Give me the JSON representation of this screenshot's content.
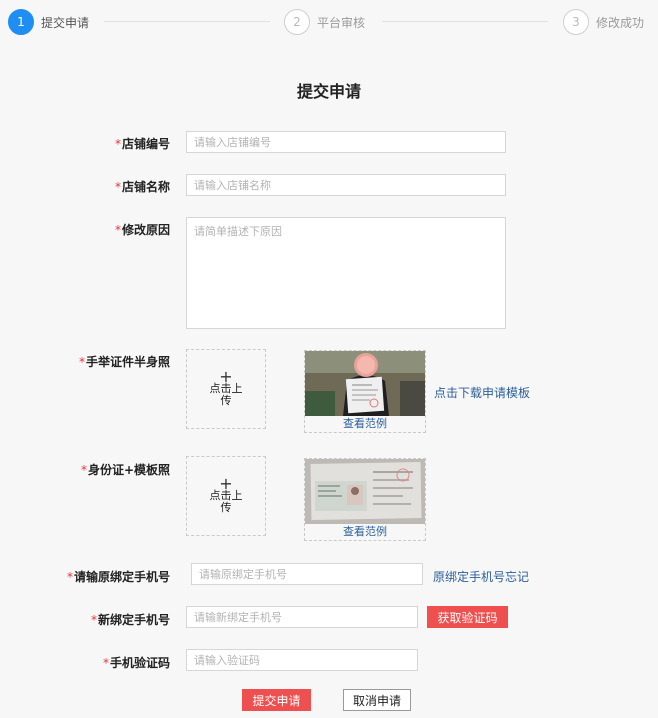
{
  "steps": [
    {
      "number": "1",
      "label": "提交申请",
      "active": true
    },
    {
      "number": "2",
      "label": "平台审核",
      "active": false
    },
    {
      "number": "3",
      "label": "修改成功",
      "active": false
    }
  ],
  "form": {
    "title": "提交申请",
    "required_mark": "*",
    "fields": {
      "shop_number": {
        "label": "店铺编号",
        "placeholder": "请输入店铺编号",
        "value": ""
      },
      "shop_name": {
        "label": "店铺名称",
        "placeholder": "请输入店铺名称",
        "value": ""
      },
      "reason": {
        "label": "修改原因",
        "placeholder": "请简单描述下原因",
        "value": ""
      },
      "handheld_photo": {
        "label": "手举证件半身照"
      },
      "id_template_photo": {
        "label": "身份证+模板照"
      },
      "original_phone": {
        "label": "请输原绑定手机号",
        "placeholder": "请输原绑定手机号",
        "value": ""
      },
      "new_phone": {
        "label": "新绑定手机号",
        "placeholder": "请输新绑定手机号",
        "value": ""
      },
      "sms_code": {
        "label": "手机验证码",
        "placeholder": "请输入验证码",
        "value": ""
      }
    },
    "upload": {
      "plus": "+",
      "text": "点击上传"
    },
    "sample_link": "查看范例",
    "download_template_link": "点击下载申请模板",
    "forgot_phone_link": "原绑定手机号忘记",
    "get_code_button": "获取验证码",
    "submit_button": "提交申请",
    "cancel_button": "取消申请"
  },
  "colors": {
    "accent": "#1e8ef3",
    "danger": "#ee5050",
    "link": "#2b5f9a",
    "required": "#ee3333"
  }
}
